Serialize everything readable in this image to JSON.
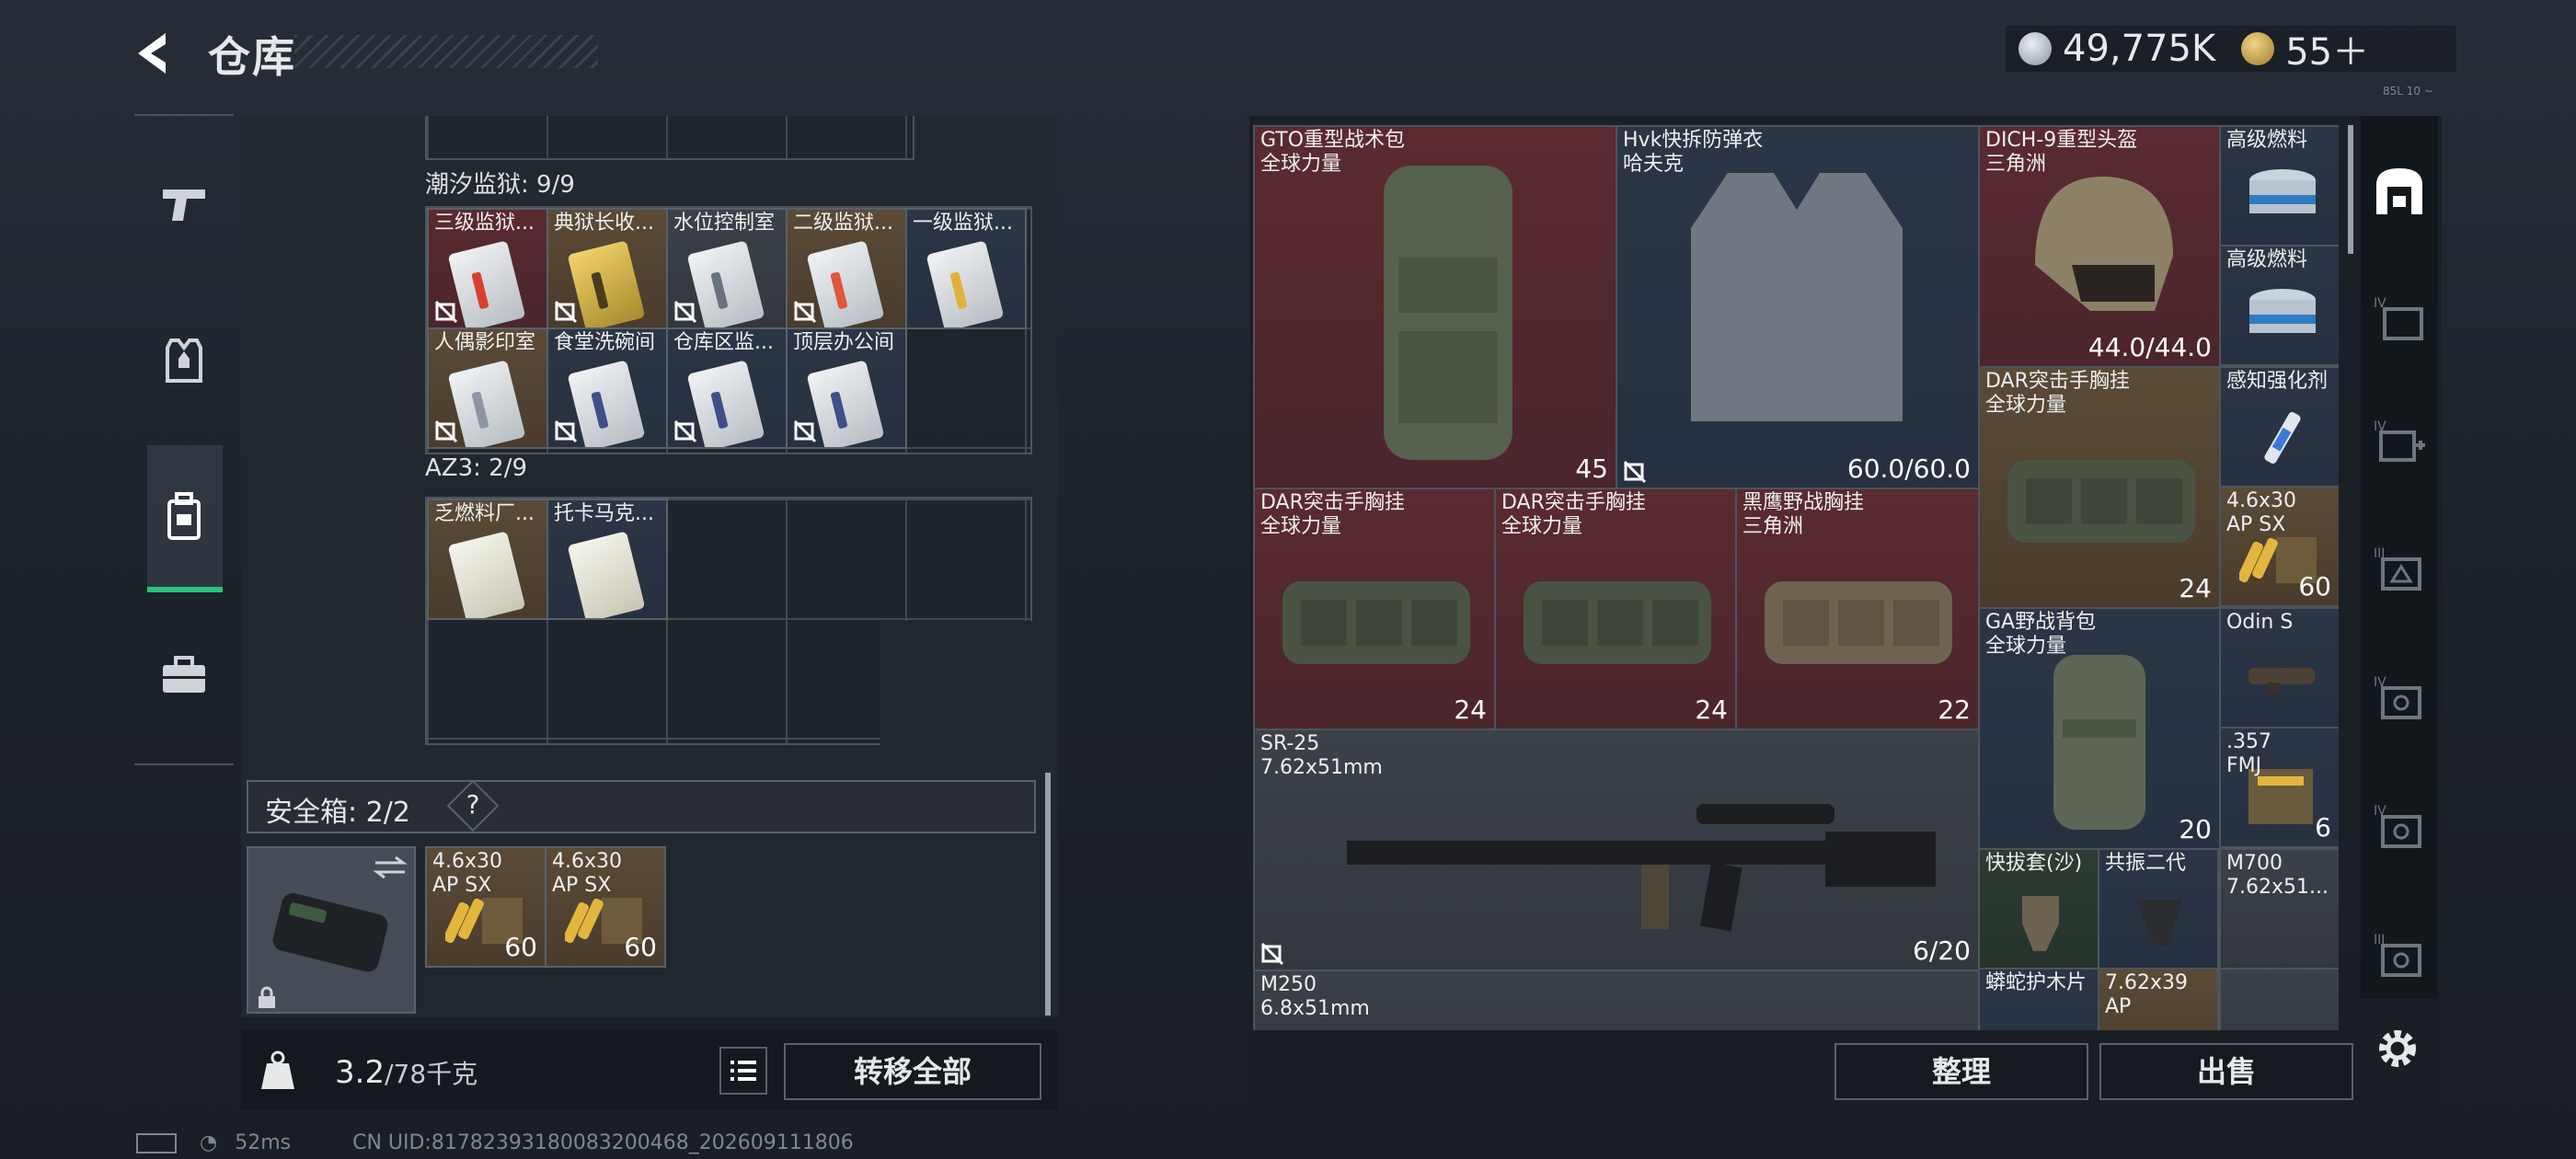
{
  "header": {
    "title": "仓库",
    "silver": "49,775K",
    "gold": "55＋",
    "tiny_corner": "85L 10 ~"
  },
  "stash": {
    "sections": [
      {
        "label": "潮汐监狱: 9/9",
        "items": [
          {
            "name": "三级监狱...",
            "bg": "red"
          },
          {
            "name": "典狱长收...",
            "bg": "gold"
          },
          {
            "name": "水位控制室",
            "bg": "gray"
          },
          {
            "name": "二级监狱...",
            "bg": "gold"
          },
          {
            "name": "一级监狱...",
            "bg": "blue"
          },
          {
            "name": "人偶影印室",
            "bg": "gold"
          },
          {
            "name": "食堂洗碗间",
            "bg": "blue"
          },
          {
            "name": "仓库区监...",
            "bg": "blue"
          },
          {
            "name": "顶层办公间",
            "bg": "blue"
          }
        ]
      },
      {
        "label": "AZ3: 2/9",
        "items": [
          {
            "name": "乏燃料厂...",
            "bg": "gold"
          },
          {
            "name": "托卡马克...",
            "bg": "blue"
          }
        ]
      }
    ],
    "safe_box": {
      "label": "安全箱: 2/2",
      "help": "?",
      "items": [
        {
          "name": "4.6x30 AP SX",
          "qty": "60"
        },
        {
          "name": "4.6x30 AP SX",
          "qty": "60"
        }
      ]
    },
    "weight": {
      "current": "3.2",
      "capacity": "/78千克"
    },
    "transfer_all": "转移全部"
  },
  "inventory": {
    "items": [
      {
        "id": "gto",
        "name": "GTO重型战术包",
        "sub": "全球力量",
        "qty": "45",
        "bg": "red"
      },
      {
        "id": "hvk",
        "name": "Hvk快拆防弹衣",
        "sub": "哈夫克",
        "qty": "60.0/60.0",
        "bg": "blue"
      },
      {
        "id": "dich",
        "name": "DICH-9重型头盔",
        "sub": "三角洲",
        "qty": "44.0/44.0",
        "bg": "red"
      },
      {
        "id": "fuel1",
        "name": "高级燃料",
        "sub": "",
        "qty": "",
        "bg": "blue"
      },
      {
        "id": "fuel2",
        "name": "高级燃料",
        "sub": "",
        "qty": "",
        "bg": "blue"
      },
      {
        "id": "dar_r",
        "name": "DAR突击手胸挂",
        "sub": "全球力量",
        "qty": "24",
        "bg": "gold"
      },
      {
        "id": "sense",
        "name": "感知强化剂",
        "sub": "",
        "qty": "",
        "bg": "blue"
      },
      {
        "id": "ammo_r",
        "name": "4.6x30 AP SX",
        "sub": "",
        "qty": "60",
        "bg": "gold"
      },
      {
        "id": "dar1",
        "name": "DAR突击手胸挂",
        "sub": "全球力量",
        "qty": "24",
        "bg": "red"
      },
      {
        "id": "dar2",
        "name": "DAR突击手胸挂",
        "sub": "全球力量",
        "qty": "24",
        "bg": "red"
      },
      {
        "id": "eagle",
        "name": "黑鹰野战胸挂",
        "sub": "三角洲",
        "qty": "22",
        "bg": "red"
      },
      {
        "id": "ga",
        "name": "GA野战背包",
        "sub": "全球力量",
        "qty": "20",
        "bg": "blue"
      },
      {
        "id": "odin",
        "name": "Odin S",
        "sub": "",
        "qty": "",
        "bg": "blue"
      },
      {
        "id": "a357",
        "name": ".357 FMJ",
        "sub": "",
        "qty": "6",
        "bg": "blue"
      },
      {
        "id": "sr25",
        "name": "SR-25",
        "sub": "7.62x51mm",
        "qty": "6/20",
        "bg": "gray"
      },
      {
        "id": "qbt",
        "name": "快拔套(沙)",
        "sub": "",
        "qty": "",
        "bg": "green"
      },
      {
        "id": "gz2",
        "name": "共振二代",
        "sub": "",
        "qty": "",
        "bg": "blue"
      },
      {
        "id": "m700",
        "name": "M700",
        "sub": "7.62x51...",
        "qty": "",
        "bg": "gray"
      },
      {
        "id": "m250",
        "name": "M250",
        "sub": "6.8x51mm",
        "qty": "",
        "bg": "gray"
      },
      {
        "id": "mang",
        "name": "蟒蛇护木片",
        "sub": "",
        "qty": "",
        "bg": "blue"
      },
      {
        "id": "a762",
        "name": "7.62x39 AP",
        "sub": "",
        "qty": "",
        "bg": "gold"
      }
    ],
    "sort": "整理",
    "sell": "出售"
  },
  "status": {
    "ping": "52ms",
    "uid": "CN UID:81782393180083200468_202609111806"
  },
  "colors": {
    "accent_green": "#29c27f",
    "red_rarity": "#5a2a2f",
    "gold_rarity": "#5a4a36",
    "blue_rarity": "#2b3546"
  }
}
